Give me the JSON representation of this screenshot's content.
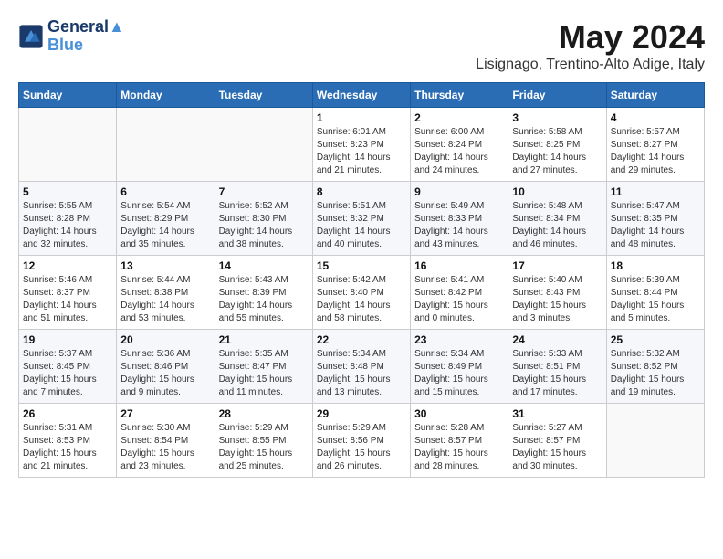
{
  "logo": {
    "line1": "General",
    "line2": "Blue"
  },
  "title": "May 2024",
  "location": "Lisignago, Trentino-Alto Adige, Italy",
  "weekdays": [
    "Sunday",
    "Monday",
    "Tuesday",
    "Wednesday",
    "Thursday",
    "Friday",
    "Saturday"
  ],
  "weeks": [
    [
      {
        "day": "",
        "info": ""
      },
      {
        "day": "",
        "info": ""
      },
      {
        "day": "",
        "info": ""
      },
      {
        "day": "1",
        "info": "Sunrise: 6:01 AM\nSunset: 8:23 PM\nDaylight: 14 hours\nand 21 minutes."
      },
      {
        "day": "2",
        "info": "Sunrise: 6:00 AM\nSunset: 8:24 PM\nDaylight: 14 hours\nand 24 minutes."
      },
      {
        "day": "3",
        "info": "Sunrise: 5:58 AM\nSunset: 8:25 PM\nDaylight: 14 hours\nand 27 minutes."
      },
      {
        "day": "4",
        "info": "Sunrise: 5:57 AM\nSunset: 8:27 PM\nDaylight: 14 hours\nand 29 minutes."
      }
    ],
    [
      {
        "day": "5",
        "info": "Sunrise: 5:55 AM\nSunset: 8:28 PM\nDaylight: 14 hours\nand 32 minutes."
      },
      {
        "day": "6",
        "info": "Sunrise: 5:54 AM\nSunset: 8:29 PM\nDaylight: 14 hours\nand 35 minutes."
      },
      {
        "day": "7",
        "info": "Sunrise: 5:52 AM\nSunset: 8:30 PM\nDaylight: 14 hours\nand 38 minutes."
      },
      {
        "day": "8",
        "info": "Sunrise: 5:51 AM\nSunset: 8:32 PM\nDaylight: 14 hours\nand 40 minutes."
      },
      {
        "day": "9",
        "info": "Sunrise: 5:49 AM\nSunset: 8:33 PM\nDaylight: 14 hours\nand 43 minutes."
      },
      {
        "day": "10",
        "info": "Sunrise: 5:48 AM\nSunset: 8:34 PM\nDaylight: 14 hours\nand 46 minutes."
      },
      {
        "day": "11",
        "info": "Sunrise: 5:47 AM\nSunset: 8:35 PM\nDaylight: 14 hours\nand 48 minutes."
      }
    ],
    [
      {
        "day": "12",
        "info": "Sunrise: 5:46 AM\nSunset: 8:37 PM\nDaylight: 14 hours\nand 51 minutes."
      },
      {
        "day": "13",
        "info": "Sunrise: 5:44 AM\nSunset: 8:38 PM\nDaylight: 14 hours\nand 53 minutes."
      },
      {
        "day": "14",
        "info": "Sunrise: 5:43 AM\nSunset: 8:39 PM\nDaylight: 14 hours\nand 55 minutes."
      },
      {
        "day": "15",
        "info": "Sunrise: 5:42 AM\nSunset: 8:40 PM\nDaylight: 14 hours\nand 58 minutes."
      },
      {
        "day": "16",
        "info": "Sunrise: 5:41 AM\nSunset: 8:42 PM\nDaylight: 15 hours\nand 0 minutes."
      },
      {
        "day": "17",
        "info": "Sunrise: 5:40 AM\nSunset: 8:43 PM\nDaylight: 15 hours\nand 3 minutes."
      },
      {
        "day": "18",
        "info": "Sunrise: 5:39 AM\nSunset: 8:44 PM\nDaylight: 15 hours\nand 5 minutes."
      }
    ],
    [
      {
        "day": "19",
        "info": "Sunrise: 5:37 AM\nSunset: 8:45 PM\nDaylight: 15 hours\nand 7 minutes."
      },
      {
        "day": "20",
        "info": "Sunrise: 5:36 AM\nSunset: 8:46 PM\nDaylight: 15 hours\nand 9 minutes."
      },
      {
        "day": "21",
        "info": "Sunrise: 5:35 AM\nSunset: 8:47 PM\nDaylight: 15 hours\nand 11 minutes."
      },
      {
        "day": "22",
        "info": "Sunrise: 5:34 AM\nSunset: 8:48 PM\nDaylight: 15 hours\nand 13 minutes."
      },
      {
        "day": "23",
        "info": "Sunrise: 5:34 AM\nSunset: 8:49 PM\nDaylight: 15 hours\nand 15 minutes."
      },
      {
        "day": "24",
        "info": "Sunrise: 5:33 AM\nSunset: 8:51 PM\nDaylight: 15 hours\nand 17 minutes."
      },
      {
        "day": "25",
        "info": "Sunrise: 5:32 AM\nSunset: 8:52 PM\nDaylight: 15 hours\nand 19 minutes."
      }
    ],
    [
      {
        "day": "26",
        "info": "Sunrise: 5:31 AM\nSunset: 8:53 PM\nDaylight: 15 hours\nand 21 minutes."
      },
      {
        "day": "27",
        "info": "Sunrise: 5:30 AM\nSunset: 8:54 PM\nDaylight: 15 hours\nand 23 minutes."
      },
      {
        "day": "28",
        "info": "Sunrise: 5:29 AM\nSunset: 8:55 PM\nDaylight: 15 hours\nand 25 minutes."
      },
      {
        "day": "29",
        "info": "Sunrise: 5:29 AM\nSunset: 8:56 PM\nDaylight: 15 hours\nand 26 minutes."
      },
      {
        "day": "30",
        "info": "Sunrise: 5:28 AM\nSunset: 8:57 PM\nDaylight: 15 hours\nand 28 minutes."
      },
      {
        "day": "31",
        "info": "Sunrise: 5:27 AM\nSunset: 8:57 PM\nDaylight: 15 hours\nand 30 minutes."
      },
      {
        "day": "",
        "info": ""
      }
    ]
  ]
}
